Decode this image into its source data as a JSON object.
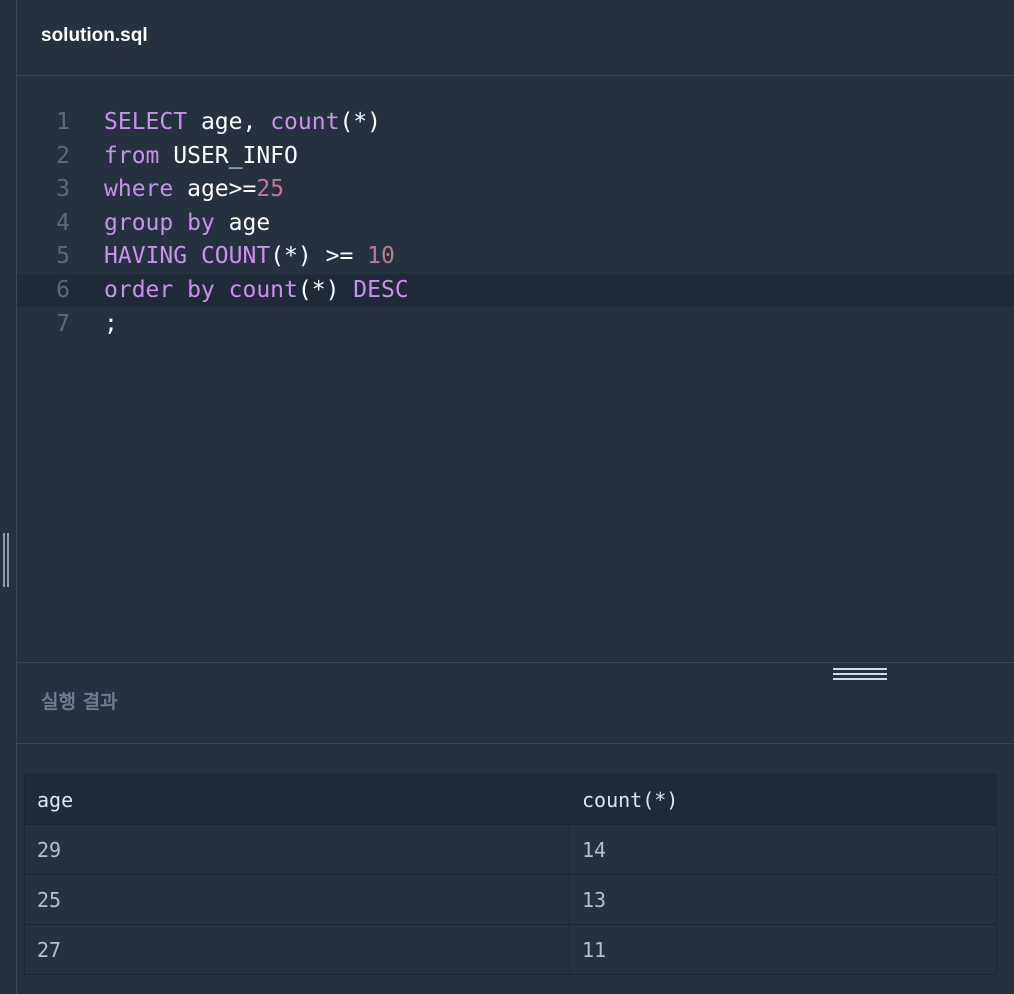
{
  "tab": {
    "title": "solution.sql"
  },
  "editor": {
    "lines": [
      {
        "number": "1",
        "text": "SELECT age, count(*)"
      },
      {
        "number": "2",
        "text": "from USER_INFO"
      },
      {
        "number": "3",
        "text": "where age>=25"
      },
      {
        "number": "4",
        "text": "group by age"
      },
      {
        "number": "5",
        "text": "HAVING COUNT(*) >= 10"
      },
      {
        "number": "6",
        "text": "order by count(*) DESC"
      },
      {
        "number": "7",
        "text": ";"
      }
    ],
    "tokens": {
      "l1": [
        "SELECT",
        " age, ",
        "count",
        "(*)"
      ],
      "l2": [
        "from",
        " USER_INFO"
      ],
      "l3": [
        "where",
        " age>=",
        "25"
      ],
      "l4": [
        "group by",
        " age"
      ],
      "l5": [
        "HAVING",
        " ",
        "COUNT",
        "(*) >= ",
        "10"
      ],
      "l6": [
        "order by",
        " ",
        "count",
        "(*) ",
        "DESC"
      ],
      "l7": [
        ";"
      ]
    }
  },
  "results": {
    "label": "실행 결과",
    "columns": [
      "age",
      "count(*)"
    ],
    "rows": [
      [
        "29",
        "14"
      ],
      [
        "25",
        "13"
      ],
      [
        "27",
        "11"
      ]
    ]
  },
  "colors": {
    "background": "#263140",
    "keyword": "#c792ea",
    "number": "#c0788f",
    "active_line": "#1f2938"
  }
}
